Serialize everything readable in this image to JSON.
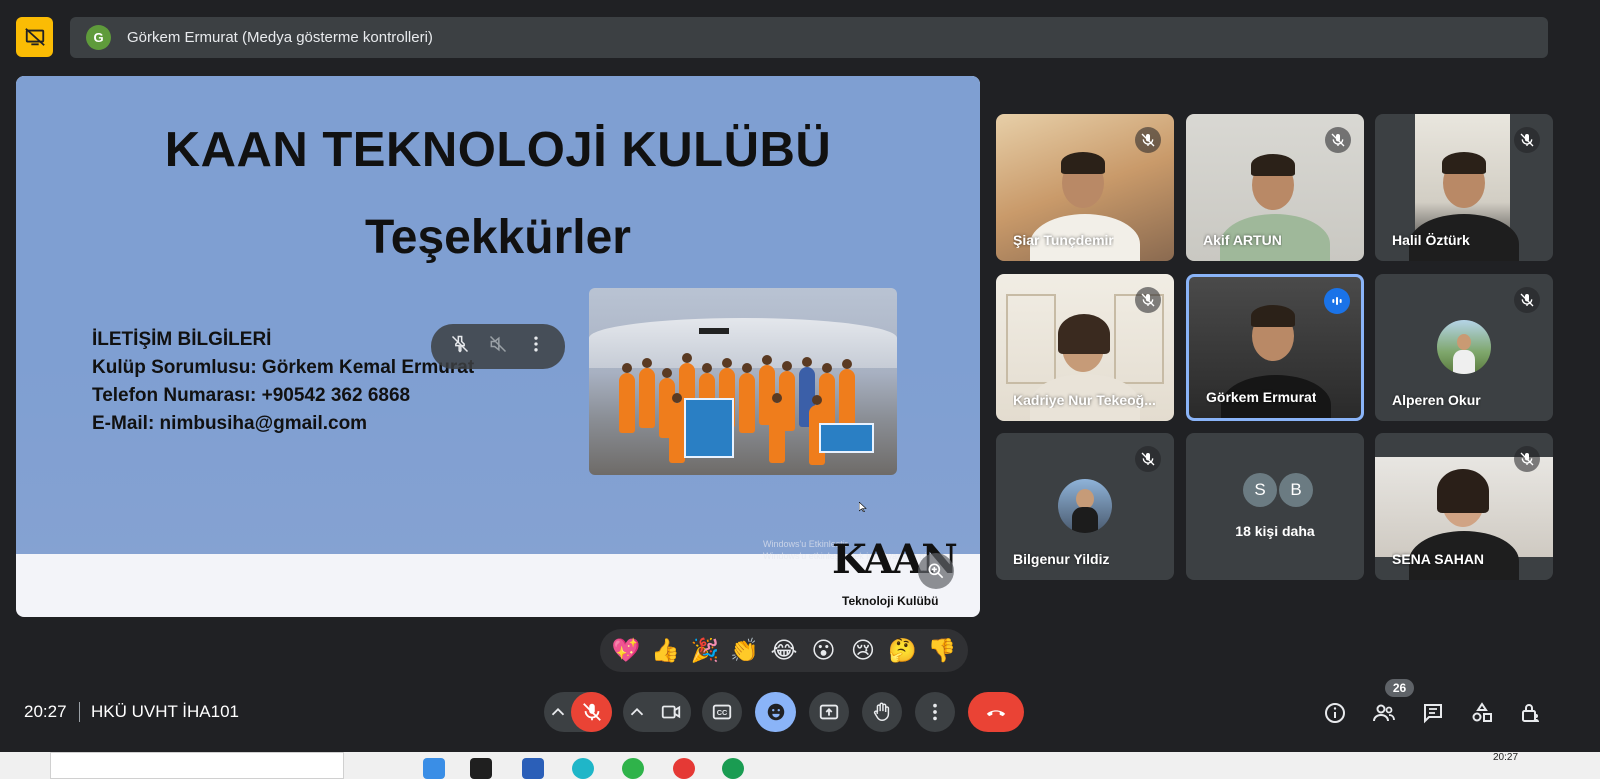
{
  "top": {
    "presenter_initial": "G",
    "presenter_title": "Görkem Ermurat (Medya gösterme kontrolleri)"
  },
  "slide": {
    "title": "KAAN TEKNOLOJİ KULÜBÜ",
    "subtitle": "Teşekkürler",
    "contact_lines": [
      "İLETİŞİM BİLGİLERİ",
      "Kulüp Sorumlusu: Görkem Kemal Ermurat",
      "Telefon Numarası: +90542 362 6868",
      "E-Mail: nimbusiha@gmail.com"
    ],
    "logo_text": "KAAN",
    "logo_sub": "Teknoloji Kulübü",
    "watermark_line1": "Windows'u Etkinleştir",
    "watermark_line2": "Windows'u etkinleştirmek için Ayarlar'a gidin."
  },
  "participants": [
    {
      "name": "Şiar Tunçdemir",
      "muted": true
    },
    {
      "name": "Akif ARTUN",
      "muted": true
    },
    {
      "name": "Halil Öztürk",
      "muted": true
    },
    {
      "name": "Kadriye Nur Tekeoğ...",
      "muted": true
    },
    {
      "name": "Görkem Ermurat",
      "muted": false,
      "speaking": true
    },
    {
      "name": "Alperen Okur",
      "muted": true
    },
    {
      "name": "Bilgenur Yildiz",
      "muted": true
    },
    {
      "name": "SENA SAHAN",
      "muted": true
    }
  ],
  "more_participants": {
    "initials": [
      "S",
      "B"
    ],
    "label": "18 kişi daha"
  },
  "reactions": [
    "💖",
    "👍",
    "🎉",
    "👏",
    "😂",
    "😮",
    "😢",
    "🤔",
    "👎"
  ],
  "bottom": {
    "time": "20:27",
    "meeting_code": "HKÜ UVHT İHA101",
    "people_count": "26"
  },
  "taskbar": {
    "time": "20:27"
  },
  "colors": {
    "background": "#202124",
    "mic_off": "#ea4335",
    "end_call": "#ea4335",
    "reactions_active": "#8ab4f8",
    "stop_share": "#fbbc04",
    "speaking": "#1a73e8"
  }
}
